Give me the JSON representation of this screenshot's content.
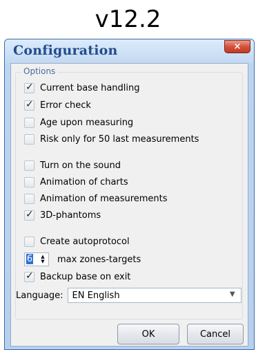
{
  "version_label": "v12.2",
  "dialog": {
    "title": "Configuration",
    "close_symbol": "×",
    "close_icon": "close-icon"
  },
  "options": {
    "legend": "Options",
    "check_glyph": "✓",
    "items": [
      {
        "label": "Current base handling",
        "checked": true
      },
      {
        "label": "Error check",
        "checked": true
      },
      {
        "label": "Age upon measuring",
        "checked": false
      },
      {
        "label": "Risk only for 50 last measurements",
        "checked": false
      },
      {
        "label": "Turn on the sound",
        "checked": false
      },
      {
        "label": "Animation of charts",
        "checked": false
      },
      {
        "label": "Animation of measurements",
        "checked": false
      },
      {
        "label": "3D-phantoms",
        "checked": true
      },
      {
        "label": "Create autoprotocol",
        "checked": false
      },
      {
        "label": "Backup base on exit",
        "checked": true
      }
    ]
  },
  "zones": {
    "value": "6",
    "label": "max zones-targets",
    "up_glyph": "▲",
    "down_glyph": "▼"
  },
  "language": {
    "label": "Language:",
    "selected": "EN  English",
    "arrow_glyph": "▼"
  },
  "buttons": {
    "ok": "OK",
    "cancel": "Cancel"
  }
}
